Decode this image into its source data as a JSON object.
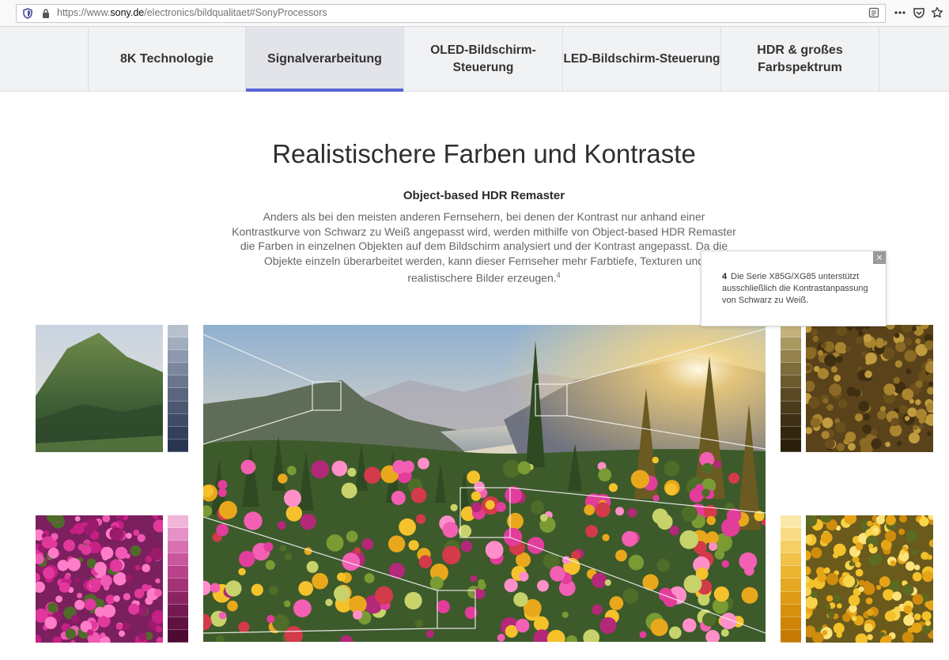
{
  "browser": {
    "url_prefix": "https://www.",
    "url_domain": "sony.de",
    "url_path": "/electronics/bildqualitaet#SonyProcessors",
    "icons": [
      "shield-icon",
      "lock-icon",
      "reader-view-icon",
      "more-icon",
      "pocket-icon",
      "bookmark-star-icon"
    ]
  },
  "nav": {
    "tabs": [
      {
        "label": "8K Technologie"
      },
      {
        "label": "Signalverarbeitung",
        "active": true
      },
      {
        "label": "OLED-Bildschirm-Steuerung"
      },
      {
        "label": "LED-Bildschirm-Steuerung"
      },
      {
        "label": "HDR & großes Farbspektrum"
      }
    ]
  },
  "content": {
    "title": "Realistischere Farben und Kontraste",
    "subtitle": "Object-based HDR Remaster",
    "paragraph": "Anders als bei den meisten anderen Fernsehern, bei denen der Kontrast nur anhand einer Kontrastkurve von Schwarz zu Weiß angepasst wird, werden mithilfe von Object-based HDR Remaster die Farben in einzelnen Objekten auf dem Bildschirm analysiert und der Kontrast angepasst. Da die Objekte einzeln überarbeitet werden, kann dieser Fernseher mehr Farbtiefe, Texturen und realistischere Bilder erzeugen.",
    "footnote_ref": "4"
  },
  "tooltip": {
    "number": "4",
    "text": "Die Serie X85G/XG85 unterstützt ausschließlich die Kontrastanpassung von Schwarz zu Weiß.",
    "close_symbol": "×"
  },
  "illustration": {
    "swatches": {
      "mountain": [
        "#b7c0cf",
        "#a1acbe",
        "#8d99ad",
        "#7b879c",
        "#6a768d",
        "#5a667f",
        "#4b5871",
        "#3e4b66",
        "#33405c",
        "#293652"
      ],
      "flowers": [
        "#f0b6da",
        "#e591c6",
        "#d871b1",
        "#c9579d",
        "#b8438a",
        "#a23376",
        "#8b2462",
        "#741a50",
        "#5f1140",
        "#4d0b33"
      ],
      "tree": [
        "#c3b27a",
        "#ab9a60",
        "#94834d",
        "#7d6c3c",
        "#6a5a2e",
        "#594924",
        "#4a3b1b",
        "#3d3014",
        "#33260f",
        "#2a1f0b"
      ],
      "yellow": [
        "#fbe8a8",
        "#f8dc84",
        "#f5cf63",
        "#f1c248",
        "#ecb532",
        "#e6a822",
        "#df9b16",
        "#d78f0e",
        "#cf8408",
        "#c67a05"
      ]
    }
  }
}
